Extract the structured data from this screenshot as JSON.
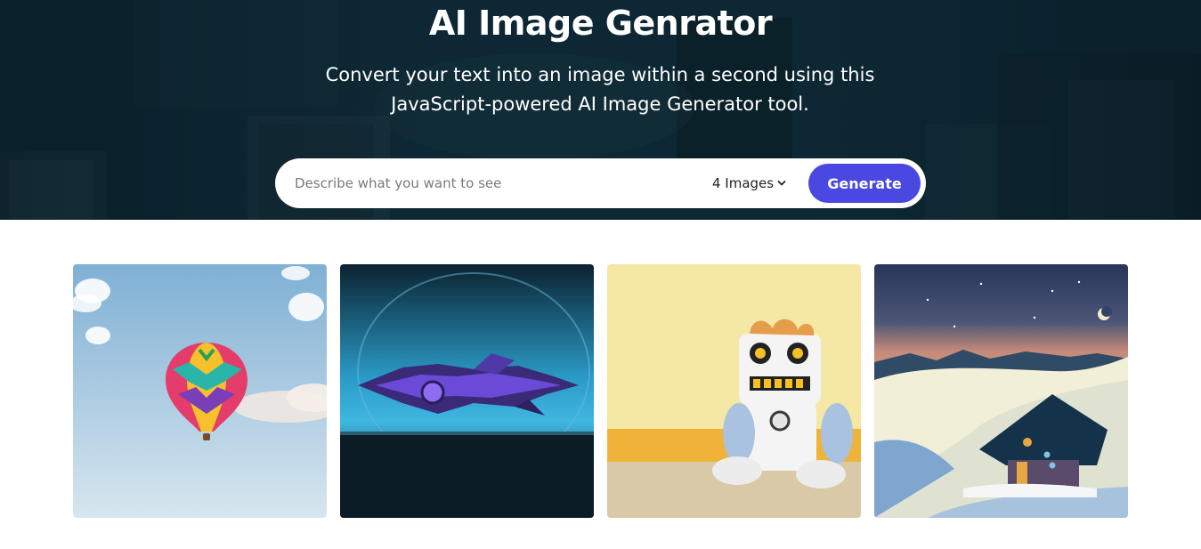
{
  "hero": {
    "title": "AI Image Genrator",
    "subtitle": "Convert your text into an image within a second using this JavaScript-powered AI Image Generator tool."
  },
  "search": {
    "placeholder": "Describe what you want to see",
    "quantity_selected": "4 Images",
    "generate_label": "Generate"
  },
  "colors": {
    "accent": "#4a48e0",
    "hero_bg": "#0d2531"
  },
  "gallery": {
    "images": [
      {
        "subject": "hot-air-balloon"
      },
      {
        "subject": "purple-spaceship"
      },
      {
        "subject": "plush-robot"
      },
      {
        "subject": "snowy-night-hut"
      }
    ]
  }
}
